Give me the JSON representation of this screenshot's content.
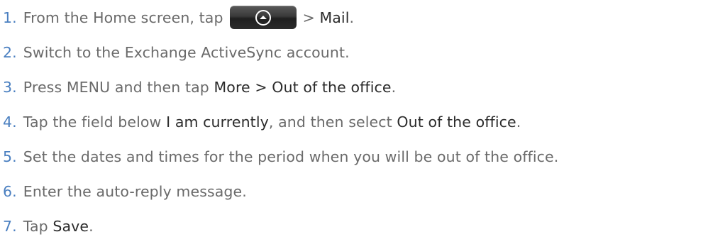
{
  "steps": [
    {
      "number": "1.",
      "text_before": "From the Home screen, tap",
      "icon": "home-all-apps-button",
      "text_sep": ">",
      "emphasis": "Mail",
      "text_after": "."
    },
    {
      "number": "2.",
      "text": "Switch to the Exchange ActiveSync account."
    },
    {
      "number": "3.",
      "text_before": "Press MENU and then tap ",
      "emphasis": "More > Out of the office",
      "text_after": "."
    },
    {
      "number": "4.",
      "text_before": "Tap the field below ",
      "emphasis": "I am currently",
      "text_middle": ", and then select ",
      "emphasis2": "Out of the office",
      "text_after": "."
    },
    {
      "number": "5.",
      "text": "Set the dates and times for the period when you will be out of the office."
    },
    {
      "number": "6.",
      "text": "Enter the auto-reply message."
    },
    {
      "number": "7.",
      "text_before": "Tap ",
      "emphasis": "Save",
      "text_after": "."
    }
  ],
  "colors": {
    "number": "#4a7fc0",
    "body_text": "#6a6a6a",
    "emphasis_text": "#2b2b2b"
  }
}
